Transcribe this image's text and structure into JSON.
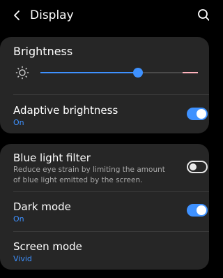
{
  "header": {
    "title": "Display",
    "back_icon": "chevron-left-icon",
    "search_icon": "search-icon"
  },
  "brightness": {
    "label": "Brightness",
    "icon": "sun-icon",
    "level": 0.62,
    "accent_color": "#3e91ff",
    "limit_color": "#ffb3bd"
  },
  "adaptive_brightness": {
    "title": "Adaptive brightness",
    "status": "On",
    "enabled": true
  },
  "blue_light_filter": {
    "title": "Blue light filter",
    "description": "Reduce eye strain by limiting the amount of blue light emitted by the screen.",
    "enabled": false
  },
  "dark_mode": {
    "title": "Dark mode",
    "status": "On",
    "enabled": true
  },
  "screen_mode": {
    "title": "Screen mode",
    "value": "Vivid"
  }
}
